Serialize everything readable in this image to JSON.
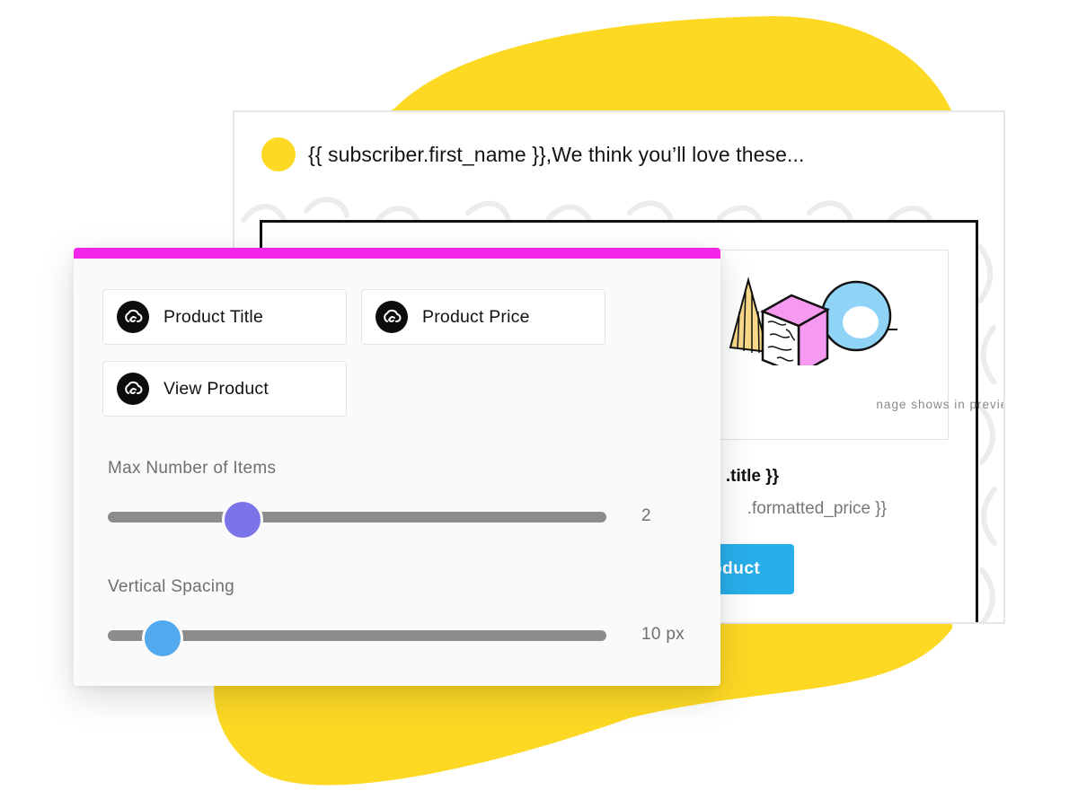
{
  "email": {
    "greeting": "{{ subscriber.first_name }},We think you’ll love these...",
    "image_caption": "nage shows in preview",
    "product_title": ".title }}",
    "product_price": ".formatted_price }}",
    "button_label": "oduct"
  },
  "panel": {
    "blocks": [
      {
        "label": "Product Title",
        "icon": "cloud-sync-icon"
      },
      {
        "label": "Product Price",
        "icon": "cloud-sync-icon"
      },
      {
        "label": "View Product",
        "icon": "cloud-sync-icon"
      }
    ],
    "sliders": [
      {
        "label": "Max Number of Items",
        "value": "2",
        "fraction": 0.27
      },
      {
        "label": "Vertical Spacing",
        "value": "10 px",
        "fraction": 0.11
      }
    ]
  },
  "colors": {
    "accent_yellow": "#FDD924",
    "panel_topbar": "#F225E8",
    "slider_thumb_items": "#7B74E8",
    "slider_thumb_spacing": "#53A9EE",
    "button_blue": "#28AEEA"
  }
}
